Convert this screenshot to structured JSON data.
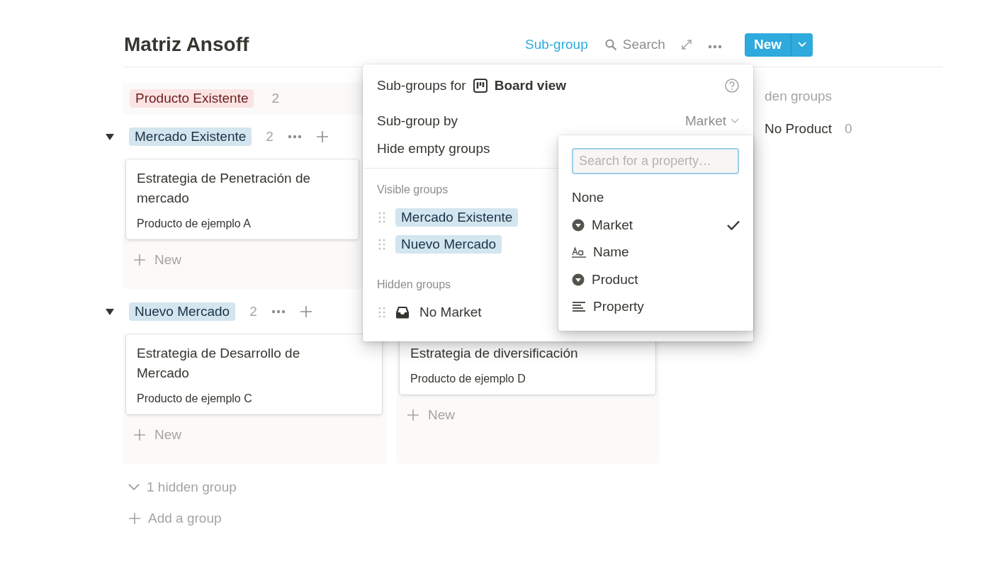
{
  "title": "Matriz Ansoff",
  "toolbar": {
    "subgroup": "Sub-group",
    "search": "Search",
    "new_button": "New"
  },
  "board": {
    "columns": [
      {
        "label": "Producto Existente",
        "count": "2",
        "color": "#fbe4e4"
      }
    ],
    "hidden_panel": {
      "title": "den groups",
      "items": [
        {
          "label": "No Product",
          "count": "0"
        }
      ]
    },
    "subgroups": [
      {
        "label": "Mercado Existente",
        "count": "2",
        "expanded": true,
        "color": "#d3e5ef",
        "cells": [
          {
            "cards": [
              {
                "title": "Estrategia de Penetración de mercado",
                "property": "Producto de ejemplo A"
              }
            ],
            "new_label": "New"
          },
          null
        ]
      },
      {
        "label": "Nuevo Mercado",
        "count": "2",
        "expanded": true,
        "color": "#d3e5ef",
        "cells": [
          {
            "cards": [
              {
                "title": "Estrategia de Desarrollo de Mercado",
                "property": "Producto de ejemplo C"
              }
            ],
            "new_label": "New"
          },
          {
            "cards": [
              {
                "title": "Estrategia de diversificación",
                "property": "Producto de ejemplo D"
              }
            ],
            "new_label": "New"
          }
        ]
      }
    ],
    "hidden_toggle": "1 hidden group",
    "add_group": "Add a group"
  },
  "popup": {
    "title_prefix": "Sub-groups for",
    "view_name": "Board view",
    "subgroup_by_label": "Sub-group by",
    "subgroup_by_value": "Market",
    "hide_empty_label": "Hide empty groups",
    "visible_title": "Visible groups",
    "visible_groups": [
      {
        "label": "Mercado Existente",
        "color": "#d3e5ef"
      },
      {
        "label": "Nuevo Mercado",
        "color": "#d3e5ef"
      }
    ],
    "hidden_title": "Hidden groups",
    "hidden_groups": [
      {
        "label": "No Market"
      }
    ],
    "property_menu": {
      "placeholder": "Search for a property…",
      "options": [
        {
          "label": "None",
          "kind": "none",
          "selected": false
        },
        {
          "label": "Market",
          "kind": "select",
          "selected": true
        },
        {
          "label": "Name",
          "kind": "title",
          "selected": false
        },
        {
          "label": "Product",
          "kind": "select",
          "selected": false
        },
        {
          "label": "Property",
          "kind": "text",
          "selected": false
        }
      ]
    }
  }
}
